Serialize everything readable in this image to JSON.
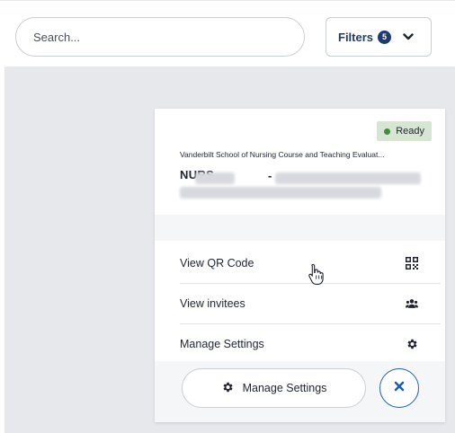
{
  "search": {
    "placeholder": "Search..."
  },
  "filters": {
    "label": "Filters",
    "count": "5"
  },
  "card": {
    "status": "Ready",
    "survey_title": "Vanderbilt School of Nursing Course and Teaching Evaluat...",
    "course_code": "NURS",
    "separator": "-"
  },
  "menu": {
    "items": [
      {
        "label": "View QR Code",
        "icon": "qr-code-icon"
      },
      {
        "label": "View invitees",
        "icon": "users-icon"
      },
      {
        "label": "Manage Settings",
        "icon": "gear-icon"
      }
    ]
  },
  "actions": {
    "manage_label": "Manage Settings",
    "close_icon": "close-icon"
  },
  "colors": {
    "accent": "#1f3b6e",
    "close_ring": "#1a5fb4",
    "ready_bg": "#d6e6d3",
    "ready_dot": "#3f8f3a"
  }
}
